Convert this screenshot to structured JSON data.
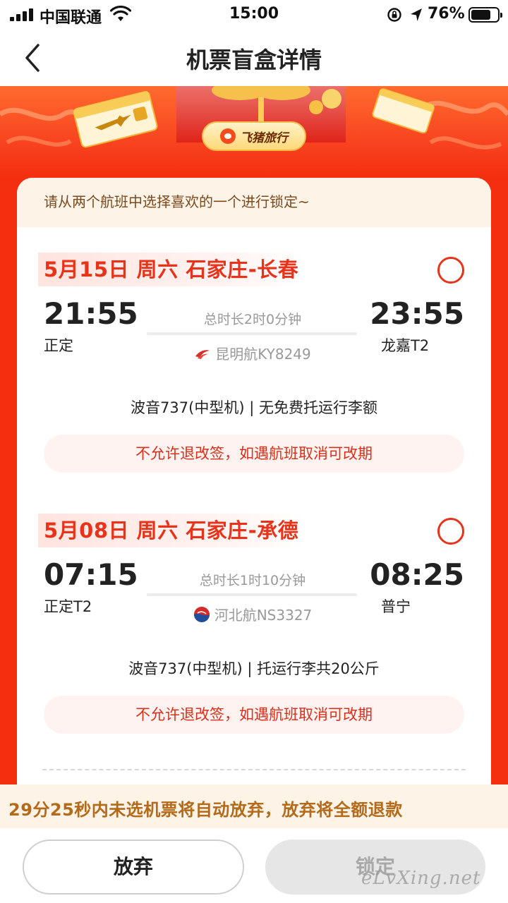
{
  "status_bar": {
    "carrier": "中国联通",
    "time": "15:00",
    "battery": "76%",
    "battery_level": 0.76
  },
  "nav": {
    "title": "机票盲盒详情"
  },
  "banner": {
    "brand": "飞猪旅行"
  },
  "card": {
    "hint": "请从两个航班中选择喜欢的一个进行锁定~"
  },
  "flights": [
    {
      "title": "5月15日 周六 石家庄-长春",
      "dep_time": "21:55",
      "dep_airport": "正定",
      "duration": "总时长2时0分钟",
      "airline": "昆明航KY8249",
      "arr_time": "23:55",
      "arr_airport": "龙嘉T2",
      "aircraft": "波音737(中型机) | 无免费托运行李额",
      "policy": "不允许退改签，如遇航班取消可改期"
    },
    {
      "title": "5月08日 周六 石家庄-承德",
      "dep_time": "07:15",
      "dep_airport": "正定T2",
      "duration": "总时长1时10分钟",
      "airline": "河北航NS3327",
      "arr_time": "08:25",
      "arr_airport": "普宁",
      "aircraft": "波音737(中型机) | 托运行李共20公斤",
      "policy": "不允许退改签，如遇航班取消可改期"
    }
  ],
  "countdown": "29分25秒内未选机票将自动放弃，放弃将全额退款",
  "buttons": {
    "give_up": "放弃",
    "lock": "锁定"
  },
  "watermark": "eLvXing.net",
  "colors": {
    "accent_red": "#e8331b",
    "page_red": "#f42f10",
    "hint_bg": "#fdf3e6"
  }
}
